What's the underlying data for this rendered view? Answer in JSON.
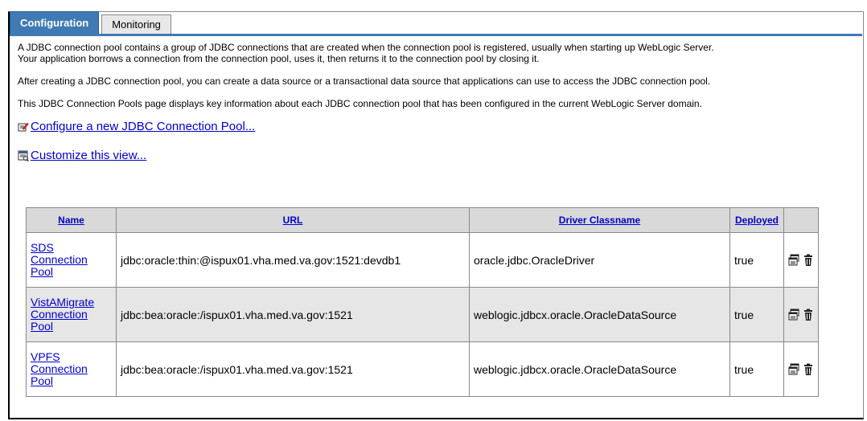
{
  "tabs": [
    {
      "label": "Configuration",
      "active": true
    },
    {
      "label": "Monitoring",
      "active": false
    }
  ],
  "description": {
    "para1_line1": "A JDBC connection pool contains a group of JDBC connections that are created when the connection pool is registered, usually when starting up WebLogic Server.",
    "para1_line2": "Your application borrows a connection from the connection pool, uses it, then returns it to the connection pool by closing it.",
    "para2": "After creating a JDBC connection pool, you can create a data source or a transactional data source that applications can use to access the JDBC connection pool.",
    "para3": "This JDBC Connection Pools page displays key information about each JDBC connection pool that has been configured in the current WebLogic Server domain."
  },
  "actions": {
    "configure_new": "Configure a new JDBC Connection Pool...",
    "customize_view": "Customize this view..."
  },
  "table": {
    "headers": [
      "Name",
      "URL",
      "Driver Classname",
      "Deployed"
    ],
    "rows": [
      {
        "name_line1": "SDS",
        "name_line2": "Connection",
        "name_line3": "Pool",
        "url": "jdbc:oracle:thin:@ispux01.vha.med.va.gov:1521:devdb1",
        "driver": "oracle.jdbc.OracleDriver",
        "deployed": "true"
      },
      {
        "name_line1": "VistAMigrate",
        "name_line2": "Connection",
        "name_line3": "Pool",
        "url": "jdbc:bea:oracle:/ispux01.vha.med.va.gov:1521",
        "driver": "weblogic.jdbcx.oracle.OracleDataSource",
        "deployed": "true"
      },
      {
        "name_line1": "VPFS",
        "name_line2": "Connection",
        "name_line3": "Pool",
        "url": "jdbc:bea:oracle:/ispux01.vha.med.va.gov:1521",
        "driver": "weblogic.jdbcx.oracle.OracleDataSource",
        "deployed": "true"
      }
    ]
  },
  "colors": {
    "tab_active": "#3f7ab5",
    "link": "#0000cc",
    "header_bg": "#d9d9d9",
    "row_alt": "#e6e6e6"
  },
  "icons": [
    "edit-pencil-icon",
    "customize-view-icon",
    "clone-icon",
    "trash-icon"
  ]
}
